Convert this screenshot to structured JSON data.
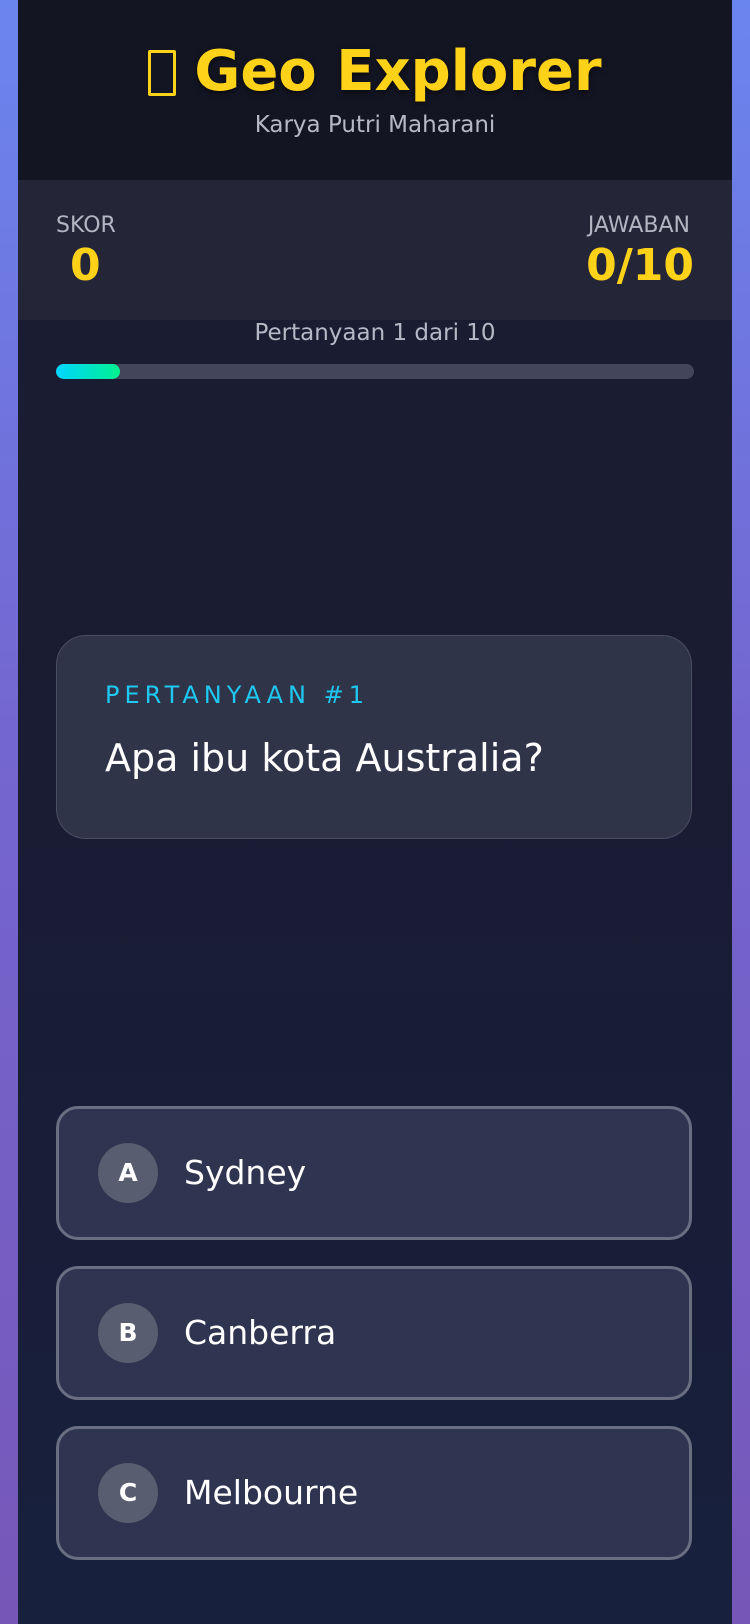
{
  "header": {
    "title": "Geo Explorer",
    "title_icon": "missing-glyph-icon",
    "subtitle": "Karya Putri Maharani"
  },
  "stats": {
    "score_label": "SKOR",
    "score_value": "0",
    "answers_label": "JAWABAN",
    "answers_value": "0/10"
  },
  "progress": {
    "text": "Pertanyaan 1 dari 10",
    "fraction": 0.1
  },
  "question": {
    "tag": "PERTANYAAN #1",
    "text": "Apa ibu kota Australia?"
  },
  "answers": [
    {
      "letter": "A",
      "text": "Sydney"
    },
    {
      "letter": "B",
      "text": "Canberra"
    },
    {
      "letter": "C",
      "text": "Melbourne"
    }
  ],
  "colors": {
    "accent": "#ffd21a",
    "tag": "#1ec8f0",
    "progress_start": "#00d6ff",
    "progress_end": "#00f08f"
  }
}
